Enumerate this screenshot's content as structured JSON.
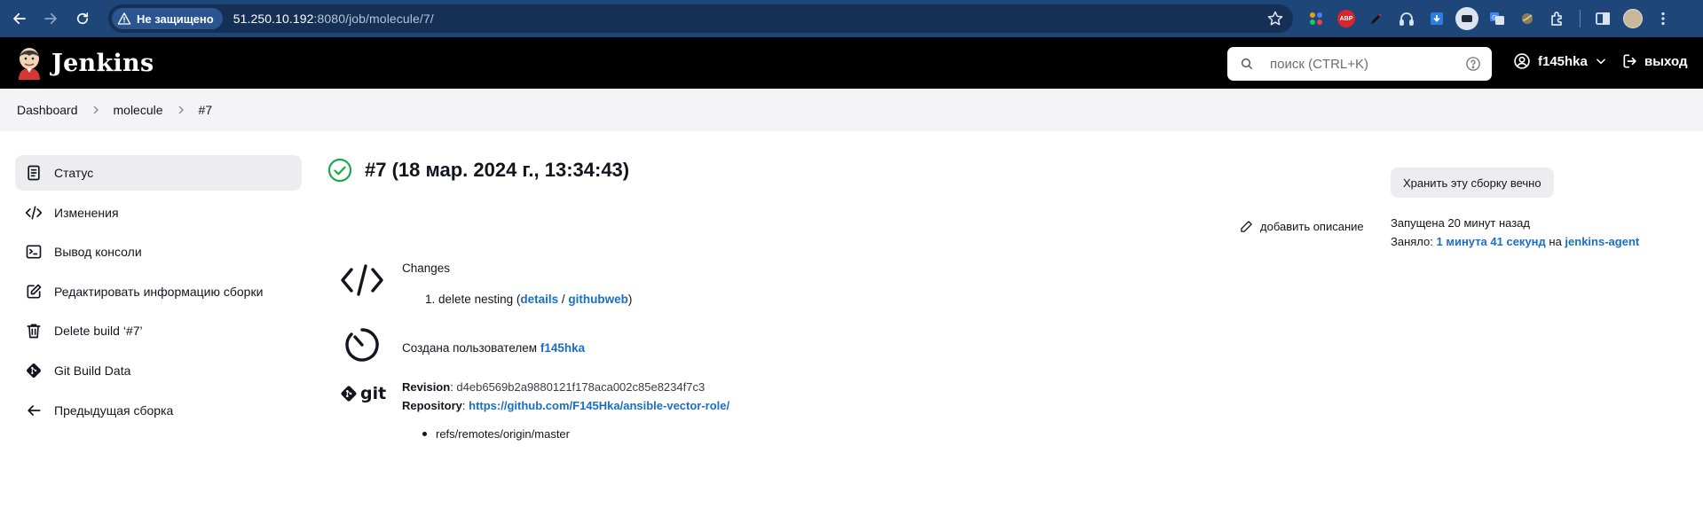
{
  "browser": {
    "security_label": "Не защищено",
    "url_host": "51.250.10.192",
    "url_rest": ":8080/job/molecule/7/",
    "extensions": [
      "grid-extension-icon",
      "adblock-icon",
      "pen-extension-icon",
      "headphones-extension-icon",
      "download-extension-icon",
      "media-extension-icon",
      "translate-extension-icon",
      "ball-extension-icon",
      "puzzle-extensions-icon"
    ],
    "abp_label": "ABP"
  },
  "header": {
    "app_name": "Jenkins",
    "search_placeholder": "поиск (CTRL+K)",
    "username": "f145hka",
    "logout_label": "выход"
  },
  "breadcrumb": [
    "Dashboard",
    "molecule",
    "#7"
  ],
  "sidebar": {
    "items": [
      {
        "label": "Статус",
        "icon": "document-icon",
        "active": true
      },
      {
        "label": "Изменения",
        "icon": "code-icon"
      },
      {
        "label": "Вывод консоли",
        "icon": "terminal-icon"
      },
      {
        "label": "Редактировать информацию сборки",
        "icon": "edit-icon"
      },
      {
        "label": "Delete build ‘#7’",
        "icon": "trash-icon"
      },
      {
        "label": "Git Build Data",
        "icon": "git-icon"
      },
      {
        "label": "Предыдущая сборка",
        "icon": "arrow-left-icon"
      }
    ]
  },
  "build": {
    "title": "#7 (18 мар. 2024 г., 13:34:43)",
    "status": "success",
    "keep_forever_label": "Хранить эту сборку вечно",
    "add_description_label": "добавить описание",
    "started": "Запущена 20 минут назад",
    "took_prefix": "Заняло: ",
    "duration": "1 минута 41 секунд",
    "on_label": " на ",
    "agent": "jenkins-agent"
  },
  "changes": {
    "title": "Changes",
    "items": [
      {
        "index": "1.",
        "message": "delete nesting",
        "details_label": "details",
        "githubweb_label": "githubweb"
      }
    ]
  },
  "created_by": {
    "prefix": "Создана пользователем ",
    "user": "f145hka"
  },
  "git": {
    "revision_label": "Revision",
    "revision": "d4eb6569b2a9880121f178aca002c85e8234f7c3",
    "repository_label": "Repository",
    "repository": "https://github.com/F145Hka/ansible-vector-role/",
    "refs": [
      "refs/remotes/origin/master"
    ],
    "logo_text": "git"
  },
  "colors": {
    "browser_bar": "#1f4678",
    "jenkins_header": "#000000",
    "link": "#1a6ec4",
    "success": "#1ea64b"
  }
}
